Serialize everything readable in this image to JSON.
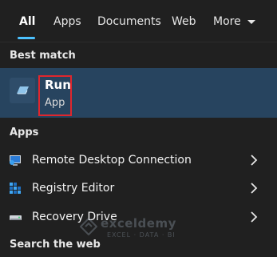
{
  "tabs": [
    {
      "label": "All",
      "active": true
    },
    {
      "label": "Apps",
      "active": false
    },
    {
      "label": "Documents",
      "active": false
    },
    {
      "label": "Web",
      "active": false
    },
    {
      "label": "More",
      "active": false
    }
  ],
  "best_match": {
    "header": "Best match",
    "title": "Run",
    "subtitle": "App"
  },
  "apps": {
    "header": "Apps",
    "items": [
      {
        "label": "Remote Desktop Connection",
        "icon": "remote-desktop-icon"
      },
      {
        "label": "Registry Editor",
        "icon": "registry-editor-icon"
      },
      {
        "label": "Recovery Drive",
        "icon": "recovery-drive-icon"
      }
    ]
  },
  "web": {
    "header": "Search the web"
  },
  "watermark": {
    "name": "exceldemy",
    "tagline": "EXCEL · DATA · BI"
  },
  "colors": {
    "accent": "#4cc2ff",
    "selection": "#27445f",
    "highlight_border": "#e0262d"
  }
}
